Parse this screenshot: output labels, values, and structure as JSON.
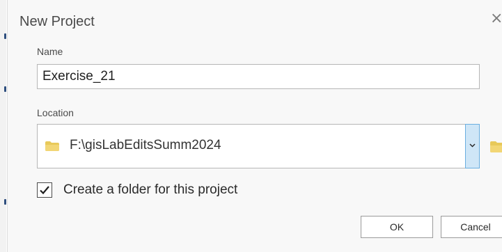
{
  "dialog": {
    "title": "New Project",
    "close_symbol": "×"
  },
  "name_field": {
    "label": "Name",
    "value": "Exercise_21"
  },
  "location_field": {
    "label": "Location",
    "value": "F:\\gisLabEditsSumm2024"
  },
  "create_folder_checkbox": {
    "label": "Create a folder for this project",
    "checked": true
  },
  "buttons": {
    "ok_label": "OK",
    "cancel_label": "Cancel"
  },
  "colors": {
    "accent": "#6aaee0",
    "dropdown_bg": "#cfe6f7",
    "folder": "#e8c95a",
    "dialog_bg": "#f8f8f8"
  },
  "icons": {
    "close": "close-icon",
    "location_folder": "folder-icon",
    "dropdown": "chevron-down-icon",
    "browse": "folder-browse-icon",
    "checkbox": "checkmark-icon"
  }
}
